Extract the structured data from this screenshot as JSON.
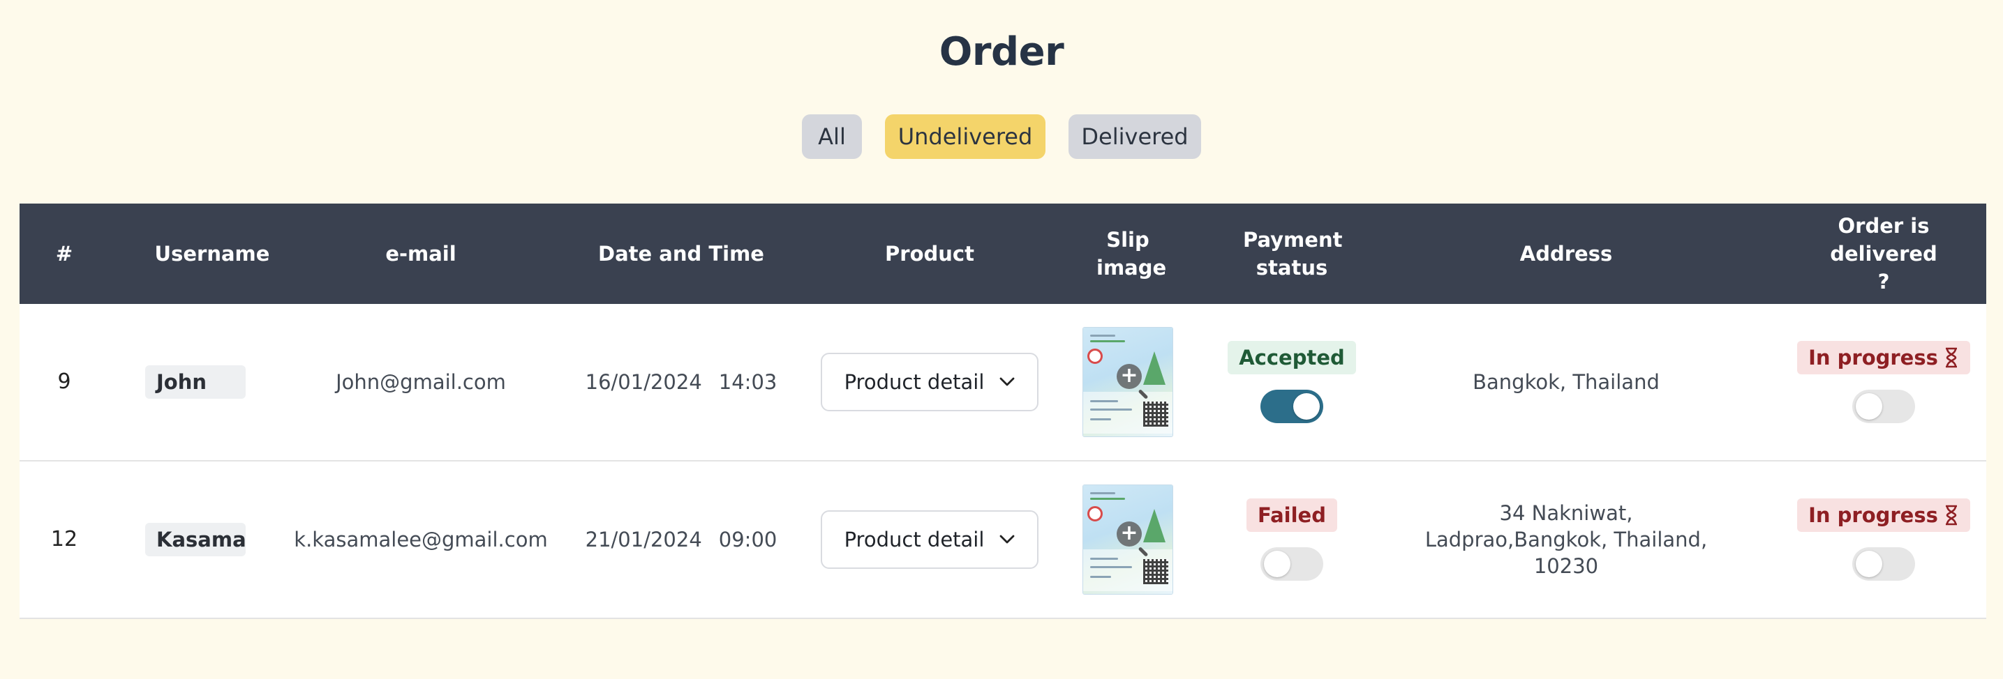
{
  "page": {
    "title": "Order"
  },
  "filters": [
    {
      "label": "All",
      "active": false
    },
    {
      "label": "Undelivered",
      "active": true
    },
    {
      "label": "Delivered",
      "active": false
    }
  ],
  "table": {
    "headers": {
      "num": "#",
      "username": "Username",
      "email": "e-mail",
      "datetime": "Date and Time",
      "product": "Product",
      "slip": "Slip image",
      "payment": "Payment status",
      "address": "Address",
      "delivered": "Order is delivered ?"
    },
    "rows": [
      {
        "num": "9",
        "username": "John",
        "email": "John@gmail.com",
        "date": "16/01/2024",
        "time": "14:03",
        "product_button": "Product detail",
        "payment_status": "Accepted",
        "payment_toggle": true,
        "address": "Bangkok, Thailand",
        "delivery_status": "In progress",
        "delivery_toggle": false
      },
      {
        "num": "12",
        "username": "Kasama",
        "email": "k.kasamalee@gmail.com",
        "date": "21/01/2024",
        "time": "09:00",
        "product_button": "Product detail",
        "payment_status": "Failed",
        "payment_toggle": false,
        "address": "34 Nakniwat, Ladprao,Bangkok, Thailand, 10230",
        "delivery_status": "In progress",
        "delivery_toggle": false
      }
    ]
  },
  "icons": {
    "dropdown": "chevron-down-icon",
    "zoom": "zoom-in-icon",
    "pending": "hourglass-icon"
  },
  "colors": {
    "background": "#fefaeb",
    "header": "#3a4150",
    "active_filter": "#f4d46a",
    "toggle_on": "#2c6e8a"
  }
}
